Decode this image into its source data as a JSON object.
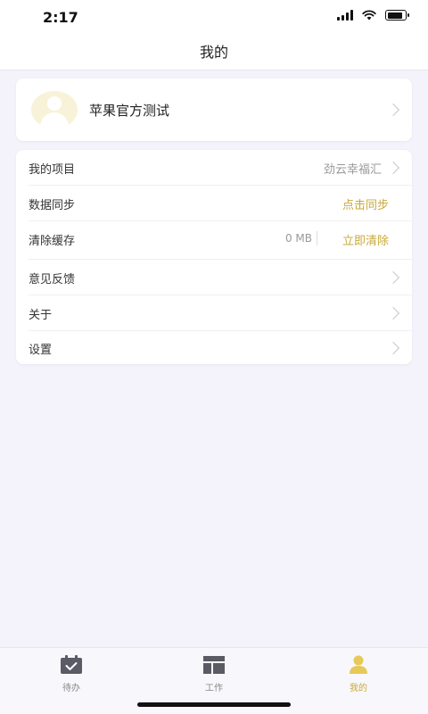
{
  "status_bar": {
    "time": "2:17"
  },
  "nav": {
    "title": "我的"
  },
  "profile": {
    "name": "苹果官方测试"
  },
  "menu": {
    "project": {
      "label": "我的项目",
      "value": "劲云幸福汇"
    },
    "sync": {
      "label": "数据同步",
      "action": "点击同步"
    },
    "cache": {
      "label": "清除缓存",
      "size": "0 MB",
      "action": "立即清除"
    },
    "feedback": {
      "label": "意见反馈"
    },
    "about": {
      "label": "关于"
    },
    "settings": {
      "label": "设置"
    }
  },
  "tabs": [
    {
      "label": "待办",
      "icon": "calendar-check-icon"
    },
    {
      "label": "工作",
      "icon": "layout-grid-icon"
    },
    {
      "label": "我的",
      "icon": "person-icon"
    }
  ],
  "colors": {
    "accent": "#c9a93b",
    "background": "#f4f2fa"
  }
}
